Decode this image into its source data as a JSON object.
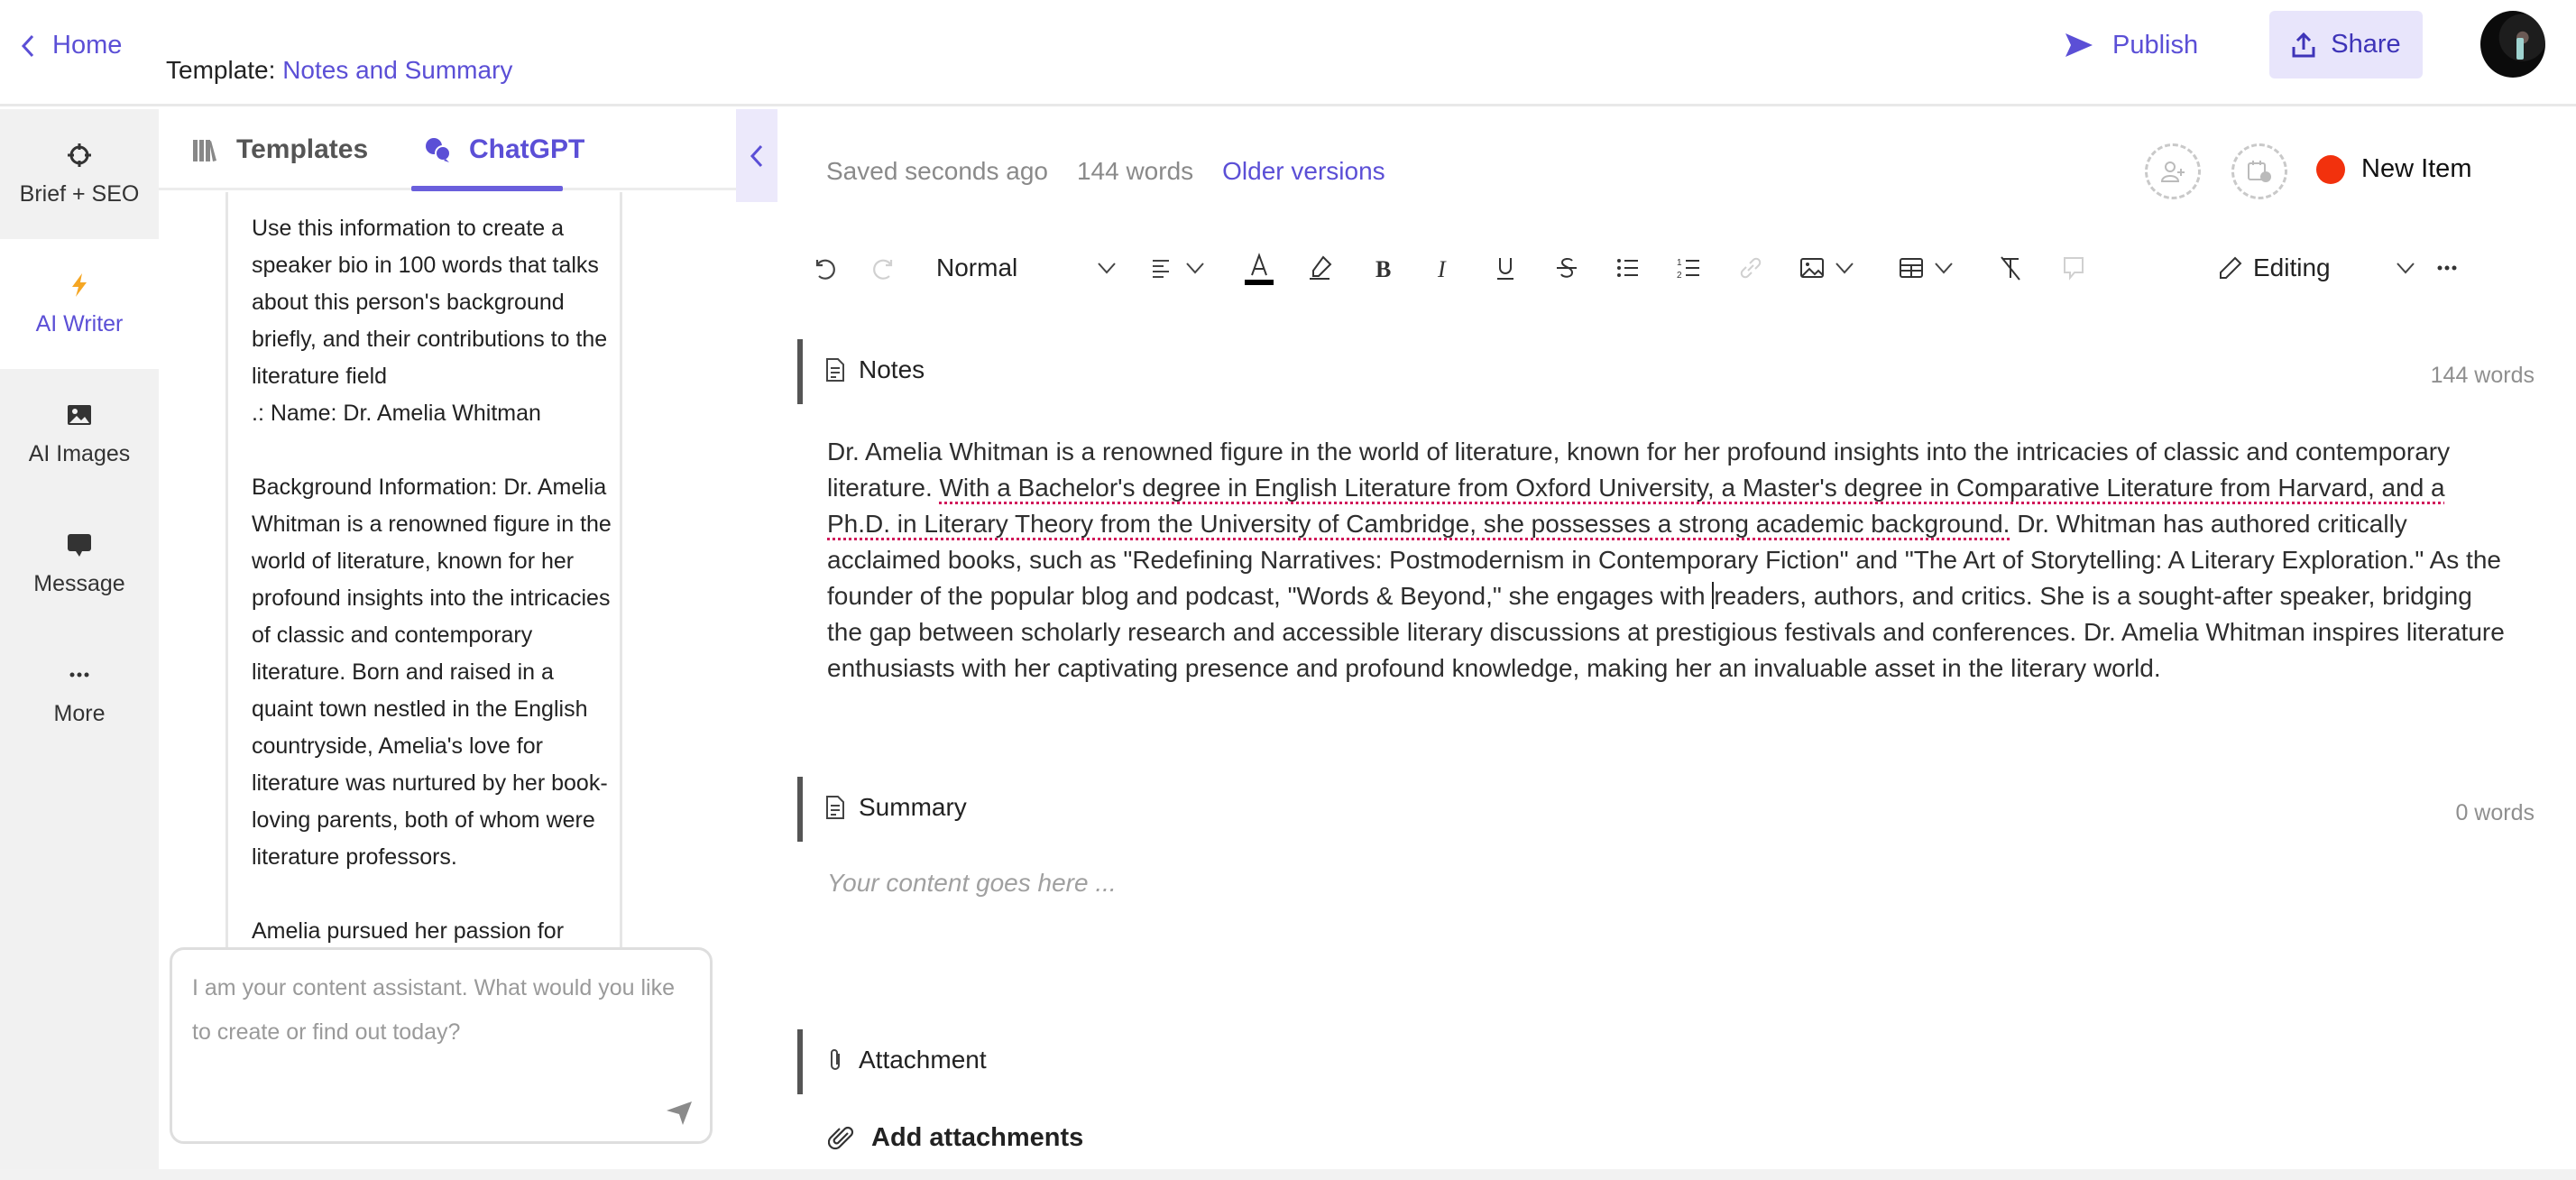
{
  "header": {
    "home_label": "Home",
    "template_prefix": "Template:",
    "template_name": "Notes and Summary",
    "publish_label": "Publish",
    "share_label": "Share"
  },
  "leftnav": {
    "items": [
      {
        "label": "Brief + SEO",
        "icon": "crosshair-icon",
        "active": false
      },
      {
        "label": "AI Writer",
        "icon": "lightning-icon",
        "active": true
      },
      {
        "label": "AI Images",
        "icon": "image-icon",
        "active": false
      },
      {
        "label": "Message",
        "icon": "message-icon",
        "active": false
      },
      {
        "label": "More",
        "icon": "more-icon",
        "active": false
      }
    ]
  },
  "chat": {
    "tabs": [
      {
        "label": "Templates",
        "active": false
      },
      {
        "label": "ChatGPT",
        "active": true
      }
    ],
    "message": "Use this information to create a speaker bio in 100 words that talks about this person's background briefly, and their contributions to the literature field\n.: Name: Dr. Amelia Whitman\n\nBackground Information: Dr. Amelia Whitman is a renowned figure in the world of literature, known for her profound insights into the intricacies of classic and contemporary literature. Born and raised in a quaint town nestled in the English countryside, Amelia's love for literature was nurtured by her book-loving parents, both of whom were literature professors.\n\nAmelia pursued her passion for literature by obtaining a Bachelor's degree in English Literature from Oxford",
    "input_placeholder": "I am your content assistant. What would you like to create or find out today?",
    "input_value": ""
  },
  "editor": {
    "status": {
      "saved": "Saved seconds ago",
      "word_count": "144 words",
      "older_versions": "Older versions"
    },
    "new_item_label": "New Item",
    "status_color": "#f2310d",
    "toolbar": {
      "style_select": "Normal",
      "mode_select": "Editing",
      "font_color": "#000000"
    },
    "sections": {
      "notes": {
        "title": "Notes",
        "count": "144 words",
        "text_before": "Dr. Amelia Whitman is a renowned figure in the world of literature, known for her profound insights into the intricacies of classic and contemporary literature. ",
        "text_flagged": "With a Bachelor's degree in English Literature from Oxford University, a Master's degree in Comparative Literature from Harvard, and a Ph.D. in Literary Theory from the University of Cambridge, she possesses a strong academic background.",
        "text_mid": " Dr. Whitman has authored critically acclaimed books, such as \"Redefining Narratives: Postmodernism in Contemporary Fiction\" and \"The Art of Storytelling: A Literary Exploration.\" As the founder of the popular blog and podcast, \"Words & Beyond,\" she engages with ",
        "text_after": "readers, authors, and critics. She is a sought-after speaker, bridging the gap between scholarly research and accessible literary discussions at prestigious festivals and conferences. Dr. Amelia Whitman inspires literature enthusiasts with her captivating presence and profound knowledge, making her an invaluable asset in the literary world."
      },
      "summary": {
        "title": "Summary",
        "count": "0 words",
        "placeholder": "Your content goes here ..."
      },
      "attachment": {
        "title": "Attachment",
        "add_label": "Add attachments"
      }
    }
  }
}
